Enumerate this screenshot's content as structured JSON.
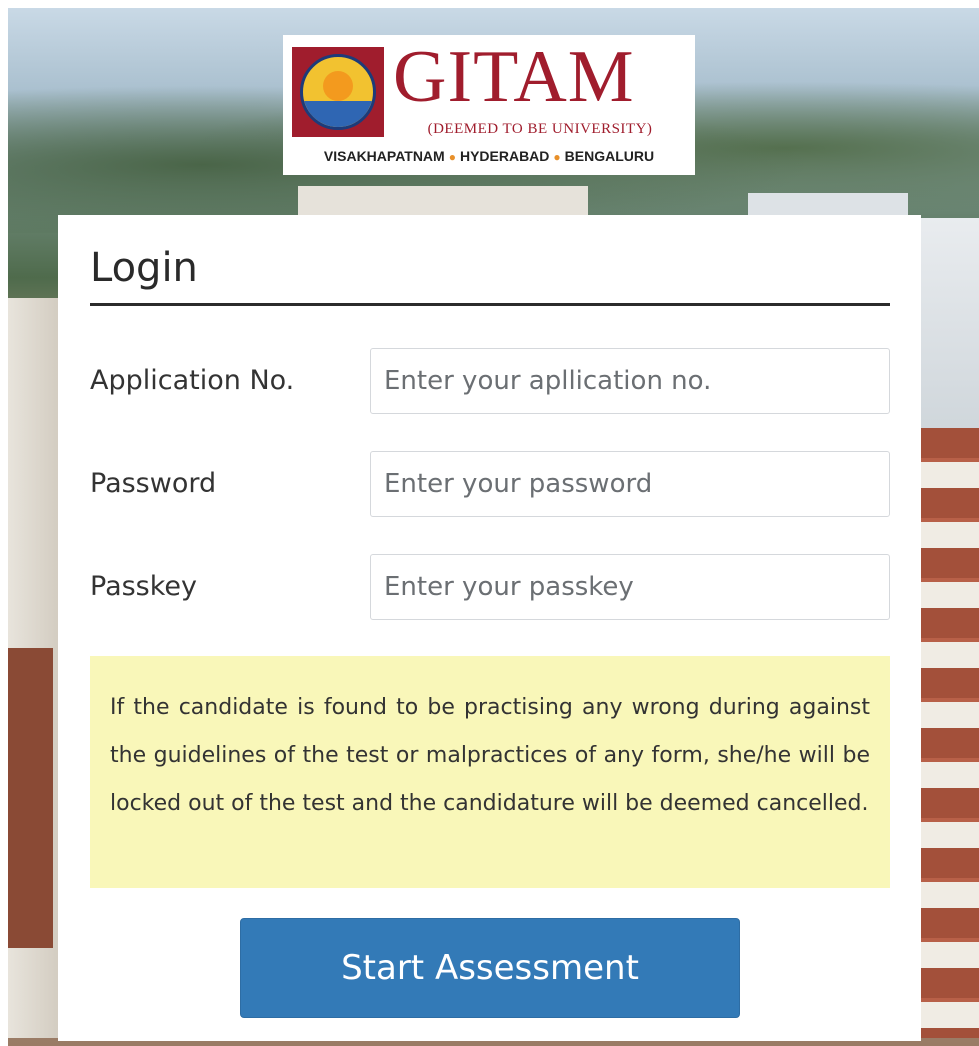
{
  "brand": {
    "name": "GITAM",
    "subtitle": "(DEEMED TO BE UNIVERSITY)",
    "cities": [
      "VISAKHAPATNAM",
      "HYDERABAD",
      "BENGALURU"
    ],
    "seal_text": "GITAM",
    "colors": {
      "maroon": "#a01d2d",
      "seal_gold": "#f2c230",
      "seal_blue": "#1d3b7a"
    }
  },
  "login": {
    "title": "Login",
    "fields": [
      {
        "label": "Application No.",
        "placeholder": "Enter your apllication no.",
        "value": ""
      },
      {
        "label": "Password",
        "placeholder": "Enter your password",
        "value": ""
      },
      {
        "label": "Passkey",
        "placeholder": "Enter your passkey",
        "value": ""
      }
    ],
    "notice": "If the candidate is found to be practising any wrong during against the guidelines of the test or malpractices of any form, she/he will be locked out of the test and the candidature will be deemed cancelled.",
    "submit_label": "Start Assessment"
  },
  "colors": {
    "button": "#337ab7",
    "notice_bg": "#f9f7b9"
  }
}
